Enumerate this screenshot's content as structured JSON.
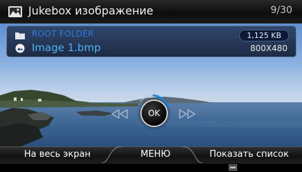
{
  "header": {
    "title": "Jukebox изображение",
    "page_counter": "9/30"
  },
  "info": {
    "folder": "ROOT FOLDER",
    "file_size": "1,125 KB",
    "file_name": "Image 1.bmp",
    "resolution": "800X480"
  },
  "controls": {
    "ok_label": "OK"
  },
  "softkeys": {
    "left": "На весь экран",
    "middle": "МЕНЮ",
    "right": "Показать список"
  },
  "colors": {
    "folder_text": "#2f7ad9",
    "file_text": "#4fb3f5",
    "accent": "#1e90e6"
  }
}
